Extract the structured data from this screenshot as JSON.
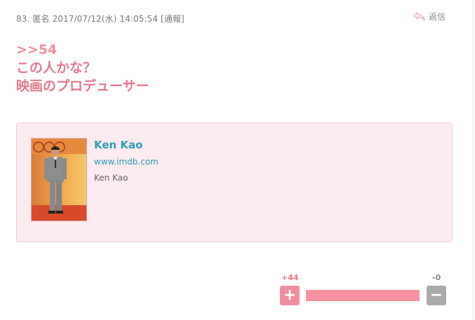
{
  "comment": {
    "number": "83.",
    "author": "匿名",
    "datetime": "2017/07/12(水) 14:05:54",
    "report_label": "[通報]",
    "reply_label": "返信",
    "anchor": ">>54",
    "lines": [
      "この人かな？",
      "映画のプロデューサー"
    ]
  },
  "link_card": {
    "title": "Ken Kao",
    "url": "www.imdb.com",
    "description": "Ken Kao"
  },
  "votes": {
    "plus_label": "+44",
    "minus_label": "-0",
    "plus_ratio": 1.0
  },
  "icons": {
    "reply": "reply-arrow-icon",
    "plus": "plus-icon",
    "minus": "minus-icon"
  },
  "colors": {
    "accent_pink": "#e8778a",
    "link_blue": "#2c9cb8",
    "card_bg": "#fcebef",
    "minus_gray": "#aaaaaa"
  }
}
